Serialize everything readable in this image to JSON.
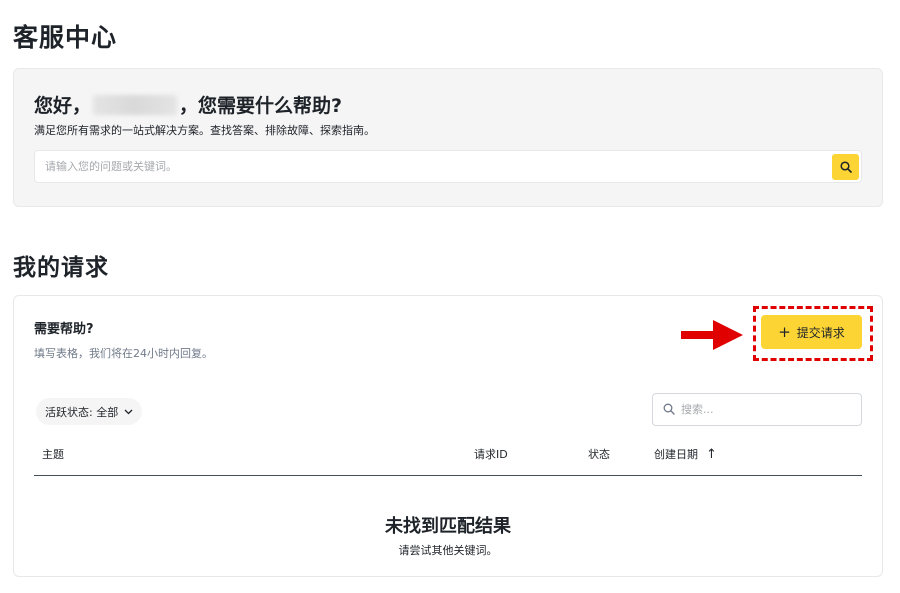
{
  "page": {
    "title": "客服中心"
  },
  "hero": {
    "greeting_prefix": "您好，",
    "greeting_suffix": "，您需要什么帮助?",
    "subtitle": "满足您所有需求的一站式解决方案。查找答案、排除故障、探索指南。",
    "search_placeholder": "请输入您的问题或关键词。",
    "search_icon": "search-icon"
  },
  "requests": {
    "section_title": "我的请求",
    "need_help_title": "需要帮助?",
    "need_help_subtitle": "填写表格，我们将在24小时内回复。",
    "submit_button": {
      "icon": "+",
      "label": "提交请求"
    },
    "filter": {
      "label": "活跃状态: 全部",
      "icon": "chevron-down-icon"
    },
    "search_placeholder": "搜索...",
    "columns": {
      "subject": "主题",
      "request_id": "请求ID",
      "status": "状态",
      "created_date": "创建日期",
      "sort_indicator": "↑"
    },
    "empty_state": {
      "title": "未找到匹配结果",
      "subtitle": "请尝试其他关键词。"
    }
  },
  "colors": {
    "accent": "#fcd535",
    "highlight": "#e00000",
    "text": "#1e2329",
    "muted": "#707a8a"
  }
}
